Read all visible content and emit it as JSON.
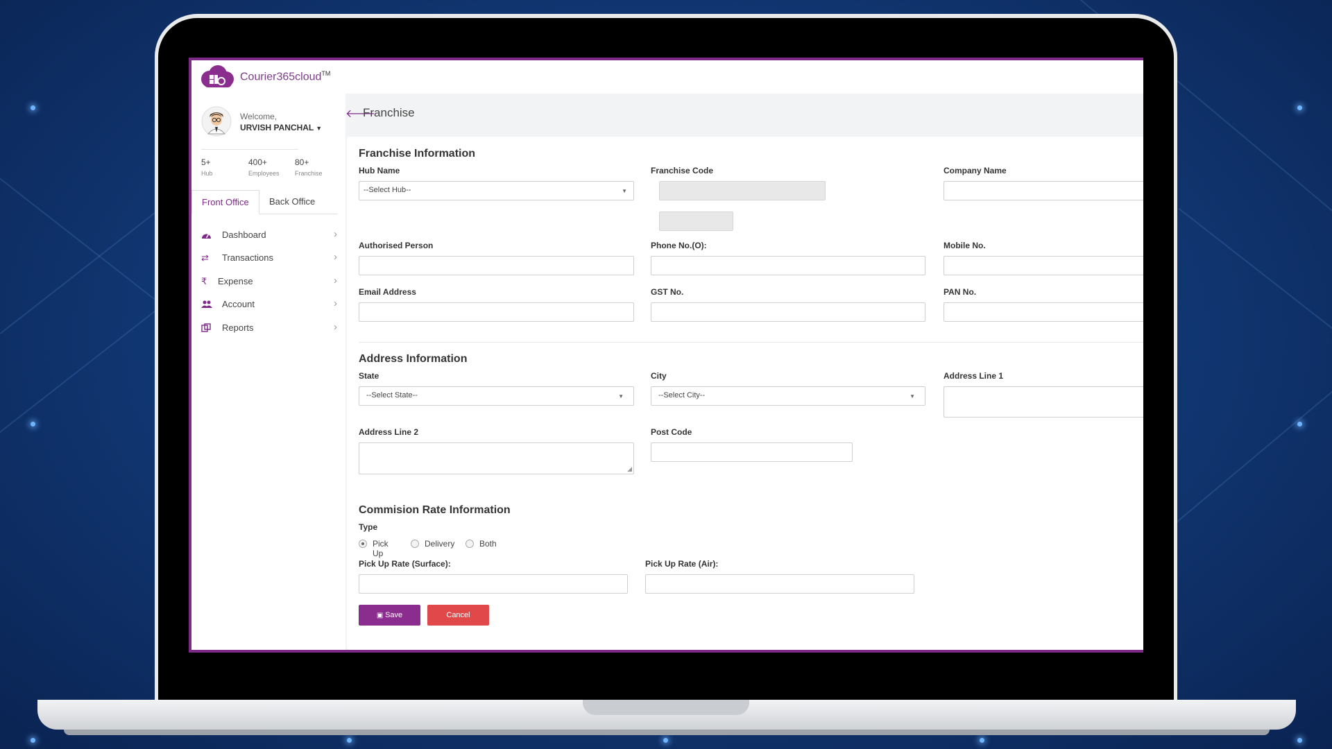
{
  "app": {
    "brand": "Courier365cloud",
    "trademark": "TM"
  },
  "user": {
    "welcome": "Welcome,",
    "name": "URVISH PANCHAL"
  },
  "stats": [
    {
      "value": "5+",
      "label": "Hub"
    },
    {
      "value": "400+",
      "label": "Employees"
    },
    {
      "value": "80+",
      "label": "Franchise"
    }
  ],
  "tabs": [
    "Front Office",
    "Back Office"
  ],
  "nav": [
    {
      "label": "Dashboard",
      "icon": "dashboard-icon"
    },
    {
      "label": "Transactions",
      "icon": "exchange-icon"
    },
    {
      "label": "Expense",
      "icon": "rupee-icon"
    },
    {
      "label": "Account",
      "icon": "users-icon"
    },
    {
      "label": "Reports",
      "icon": "reports-icon"
    }
  ],
  "page": {
    "title": "Franchise"
  },
  "franchise_info": {
    "title": "Franchise Information",
    "hub_name": {
      "label": "Hub Name",
      "value": "--Select Hub--"
    },
    "franchise_code": {
      "label": "Franchise Code",
      "value": ""
    },
    "company_name": {
      "label": "Company Name",
      "value": ""
    },
    "authorised_person": {
      "label": "Authorised Person",
      "value": ""
    },
    "phone": {
      "label": "Phone No.(O):",
      "value": ""
    },
    "mobile": {
      "label": "Mobile No.",
      "value": ""
    },
    "email": {
      "label": "Email Address",
      "value": ""
    },
    "gst": {
      "label": "GST No.",
      "value": ""
    },
    "pan": {
      "label": "PAN No.",
      "value": ""
    }
  },
  "address_info": {
    "title": "Address Information",
    "state": {
      "label": "State",
      "value": "--Select State--"
    },
    "city": {
      "label": "City",
      "value": "--Select City--"
    },
    "address1": {
      "label": "Address Line 1",
      "value": ""
    },
    "address2": {
      "label": "Address Line 2",
      "value": ""
    },
    "post_code": {
      "label": "Post Code",
      "value": ""
    }
  },
  "commission_info": {
    "title": "Commision Rate Information",
    "type_label": "Type",
    "options": [
      "Pick Up",
      "Delivery",
      "Both"
    ],
    "selected": "Pick Up",
    "pickup_surface": {
      "label": "Pick Up Rate (Surface):",
      "value": ""
    },
    "pickup_air": {
      "label": "Pick Up Rate (Air):",
      "value": ""
    }
  },
  "actions": {
    "save": "Save",
    "cancel": "Cancel"
  },
  "colors": {
    "accent": "#7c2a86",
    "save": "#8a2d8e",
    "cancel": "#e0484a",
    "background": "#123a78"
  }
}
